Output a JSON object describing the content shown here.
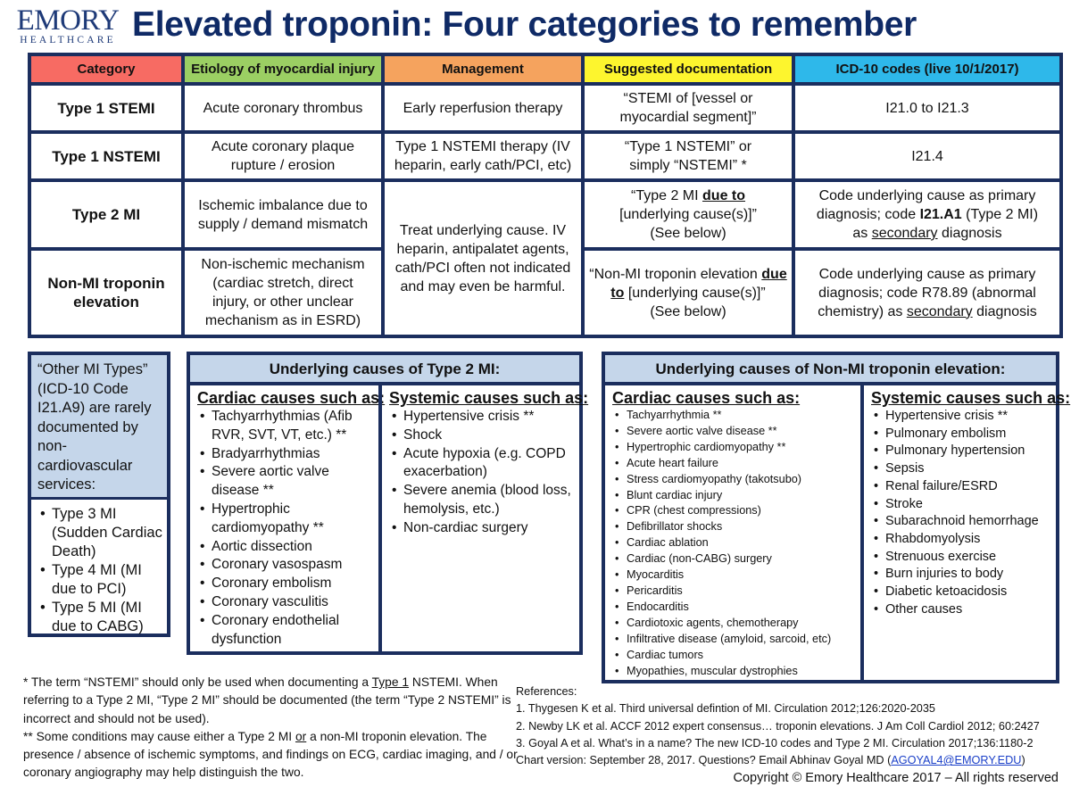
{
  "logo": {
    "line1": "EMORY",
    "line2": "HEALTHCARE"
  },
  "title": "Elevated troponin: Four categories to remember",
  "colors": {
    "header_category": "#f76b63",
    "header_etiology": "#9bcf63",
    "header_management": "#f5a35e",
    "header_documentation": "#fdf52e",
    "header_icd": "#2eb8ea",
    "border": "#1b2e5e",
    "panel_fill": "#c5d6ea",
    "title": "#0f2a66"
  },
  "table": {
    "headers": [
      "Category",
      "Etiology of myocardial injury",
      "Management",
      "Suggested documentation",
      "ICD-10 codes (live 10/1/2017)"
    ],
    "rows": [
      {
        "category": "Type 1 STEMI",
        "etiology": "Acute coronary thrombus",
        "management": "Early reperfusion therapy",
        "documentation": "“STEMI of [vessel or myocardial segment]”",
        "icd": "I21.0 to I21.3"
      },
      {
        "category": "Type 1 NSTEMI",
        "etiology": "Acute coronary plaque rupture / erosion",
        "management": "Type 1 NSTEMI therapy (IV heparin, early cath/PCI, etc)",
        "documentation": "“Type 1 NSTEMI” or simply “NSTEMI” *",
        "icd": "I21.4"
      },
      {
        "category": "Type 2 MI",
        "etiology": "Ischemic imbalance due to supply / demand mismatch",
        "management_shared": "Treat underlying cause.  IV heparin, antipalatet agents, cath/PCI often not indicated and may even be harmful.",
        "documentation": {
          "pre": "“Type 2 MI ",
          "bold_u": "due to",
          "post": " [underlying cause(s)]”",
          "note": "(See below)"
        },
        "icd": {
          "pre": "Code underlying cause as primary diagnosis; code ",
          "bold": "I21.A1",
          "mid": " (Type 2 MI) as ",
          "u": "secondary",
          "post": " diagnosis"
        }
      },
      {
        "category": "Non-MI troponin elevation",
        "etiology": "Non-ischemic mechanism (cardiac stretch, direct injury, or other unclear mechanism as in ESRD)",
        "documentation": {
          "pre": "“Non-MI troponin elevation ",
          "bold_u": "due to",
          "post": " [underlying cause(s)]”",
          "note": "(See below)"
        },
        "icd": {
          "pre": "Code underlying cause as primary diagnosis; code R78.89 (abnormal chemistry) as ",
          "u": "secondary",
          "post": " diagnosis"
        }
      }
    ]
  },
  "other_types": {
    "intro": "“Other MI Types” (ICD-10 Code I21.A9) are rarely documented by non-cardiovascular services:",
    "items": [
      "Type 3 MI (Sudden Cardiac Death)",
      "Type 4 MI (MI due to PCI)",
      "Type 5 MI (MI due to CABG)"
    ]
  },
  "type2_causes": {
    "title": "Underlying causes of Type 2 MI:",
    "cardiac_heading": "Cardiac causes such as:",
    "cardiac": [
      "Tachyarrhythmias (Afib RVR, SVT, VT, etc.) **",
      "Bradyarrhythmias",
      "Severe aortic valve disease **",
      "Hypertrophic cardiomyopathy **",
      "Aortic dissection",
      "Coronary vasospasm",
      "Coronary embolism",
      "Coronary vasculitis",
      "Coronary endothelial dysfunction"
    ],
    "systemic_heading": "Systemic causes such as:",
    "systemic": [
      "Hypertensive crisis **",
      "Shock",
      "Acute hypoxia (e.g. COPD exacerbation)",
      "Severe anemia (blood loss, hemolysis, etc.)",
      "Non-cardiac surgery"
    ]
  },
  "nonmi_causes": {
    "title": "Underlying causes of Non-MI troponin elevation:",
    "cardiac_heading": "Cardiac causes such as:",
    "cardiac": [
      "Tachyarrhythmia **",
      "Severe aortic valve disease **",
      "Hypertrophic cardiomyopathy **",
      "Acute heart failure",
      "Stress cardiomyopathy (takotsubo)",
      "Blunt cardiac injury",
      "CPR (chest compressions)",
      "Defibrillator shocks",
      "Cardiac ablation",
      "Cardiac (non-CABG) surgery",
      "Myocarditis",
      "Pericarditis",
      "Endocarditis",
      "Cardiotoxic agents, chemotherapy",
      "Infiltrative disease (amyloid, sarcoid, etc)",
      "Cardiac tumors",
      "Myopathies, muscular dystrophies"
    ],
    "systemic_heading": "Systemic causes such as:",
    "systemic": [
      "Hypertensive crisis **",
      "Pulmonary embolism",
      "Pulmonary hypertension",
      "Sepsis",
      "Renal failure/ESRD",
      "Stroke",
      "Subarachnoid hemorrhage",
      "Rhabdomyolysis",
      "Strenuous exercise",
      "Burn injuries to body",
      "Diabetic ketoacidosis",
      "Other causes"
    ]
  },
  "footnotes": {
    "n1_pre": "*  The term “NSTEMI” should only be used when documenting a ",
    "n1_u": "Type 1",
    "n1_post": " NSTEMI.  When referring to a Type 2 MI, “Type 2 MI” should be documented (the term “Type 2 NSTEMI” is incorrect and should not be used).",
    "n2_pre": "** Some conditions may cause either a Type 2 MI ",
    "n2_u": "or",
    "n2_post": " a non-MI troponin elevation. The presence / absence of ischemic symptoms, and findings on ECG, cardiac imaging, and / or coronary angiography may help distinguish the two."
  },
  "references": {
    "heading": "References:",
    "items": [
      "1. Thygesen K et al. Third universal defintion of MI.  Circulation 2012;126:2020-2035",
      "2. Newby LK et al. ACCF 2012 expert consensus… troponin elevations.  J Am Coll Cardiol 2012; 60:2427",
      "3. Goyal A et al. What’s in a name?  The new ICD-10 codes and Type 2 MI. Circulation 2017;136:1180-2"
    ],
    "version_pre": "Chart version:  September 28, 2017.  Questions?  Email Abhinav Goyal MD (",
    "email": "AGOYAL4@EMORY.EDU",
    "version_post": ")"
  },
  "copyright": "Copyright © Emory Healthcare 2017 – All rights reserved"
}
